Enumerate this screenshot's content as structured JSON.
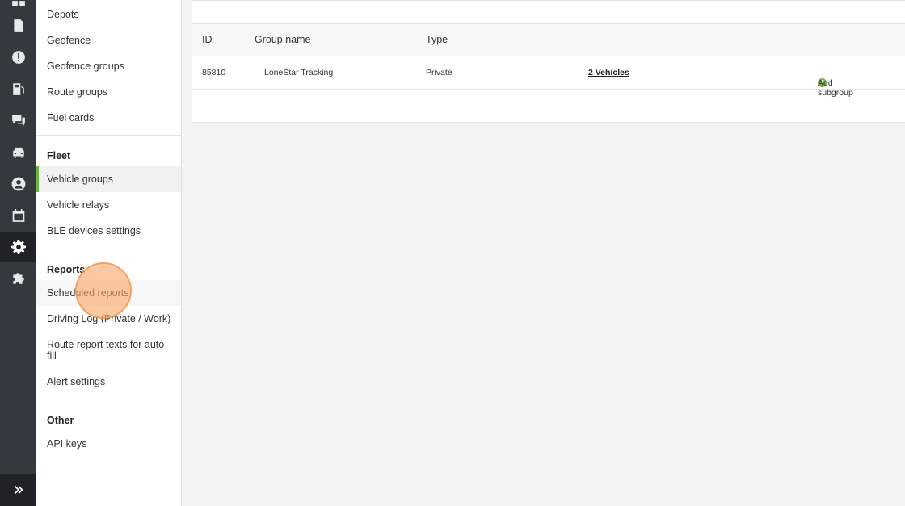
{
  "rail": {
    "icons": [
      "grid-icon",
      "document-icon",
      "alert-badge-icon",
      "fuel-pump-icon",
      "chat-icon",
      "car-icon",
      "user-icon",
      "calendar-icon",
      "gear-icon",
      "puzzle-icon"
    ],
    "active": "gear-icon",
    "expand_icon": "double-chevron-right-icon"
  },
  "sidebar": {
    "top_items": [
      "Depots",
      "Geofence",
      "Geofence groups",
      "Route groups",
      "Fuel cards"
    ],
    "fleet": {
      "heading": "Fleet",
      "items": [
        "Vehicle groups",
        "Vehicle relays",
        "BLE devices settings"
      ],
      "active": "Vehicle groups"
    },
    "reports": {
      "heading": "Reports",
      "items": [
        "Scheduled reports",
        "Driving Log (Private / Work)",
        "Route report texts for auto fill",
        "Alert settings"
      ]
    },
    "other": {
      "heading": "Other",
      "items": [
        "API keys"
      ]
    }
  },
  "table": {
    "columns": [
      "ID",
      "Group name",
      "Type"
    ],
    "rows": [
      {
        "id": "85810",
        "group_name": "LoneStar Tracking",
        "type": "Private",
        "vehicles": "2 Vehicles",
        "action": "Add subgroup"
      }
    ]
  },
  "colors": {
    "rail_bg": "#33393f",
    "accent": "#6cb33f",
    "link": "#2f6fb5"
  }
}
